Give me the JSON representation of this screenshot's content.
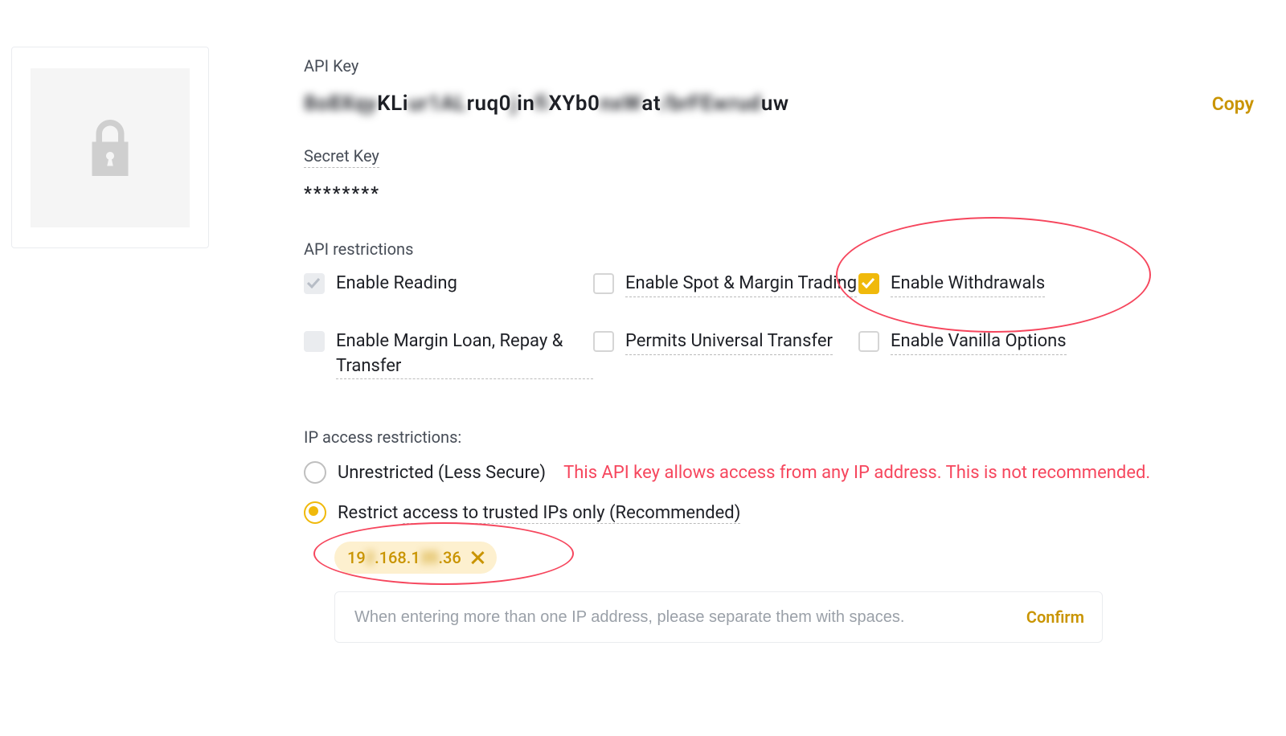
{
  "icons": {
    "lock": "lock-icon"
  },
  "api_key": {
    "label": "API Key",
    "value_seg1": "8o8Xqy",
    "value_seg2": "KLi",
    "value_seg3": "ur1AL",
    "value_seg4": "ruq0",
    "value_seg5": "j",
    "value_seg6": "in",
    "value_seg7": "fi",
    "value_seg8": "XYb0",
    "value_seg9": "nxW",
    "value_seg10": "at",
    "value_seg11": "/brFEw",
    "value_seg12": "rud",
    "value_seg13": "uw",
    "copy": "Copy"
  },
  "secret_key": {
    "label": "Secret Key",
    "value": "********"
  },
  "restrictions": {
    "label": "API restrictions",
    "reading": "Enable Reading",
    "spot": "Enable Spot & Margin Trading",
    "withdrawals": "Enable Withdrawals",
    "margin_loan": "Enable Margin Loan, Repay & Transfer",
    "universal": "Permits Universal Transfer",
    "vanilla": "Enable Vanilla Options"
  },
  "ip": {
    "label": "IP access restrictions:",
    "unrestricted": "Unrestricted (Less Secure)",
    "warning": "This API key allows access from any IP address. This is not recommended.",
    "restrict_pre": "Restrict ",
    "restrict_mid": "access to trusted IPs only (Recommended)",
    "chip_a": "19",
    "chip_b": ".168.1",
    "chip_c": ".36",
    "placeholder": "When entering more than one IP address, please separate them with spaces.",
    "confirm": "Confirm"
  }
}
